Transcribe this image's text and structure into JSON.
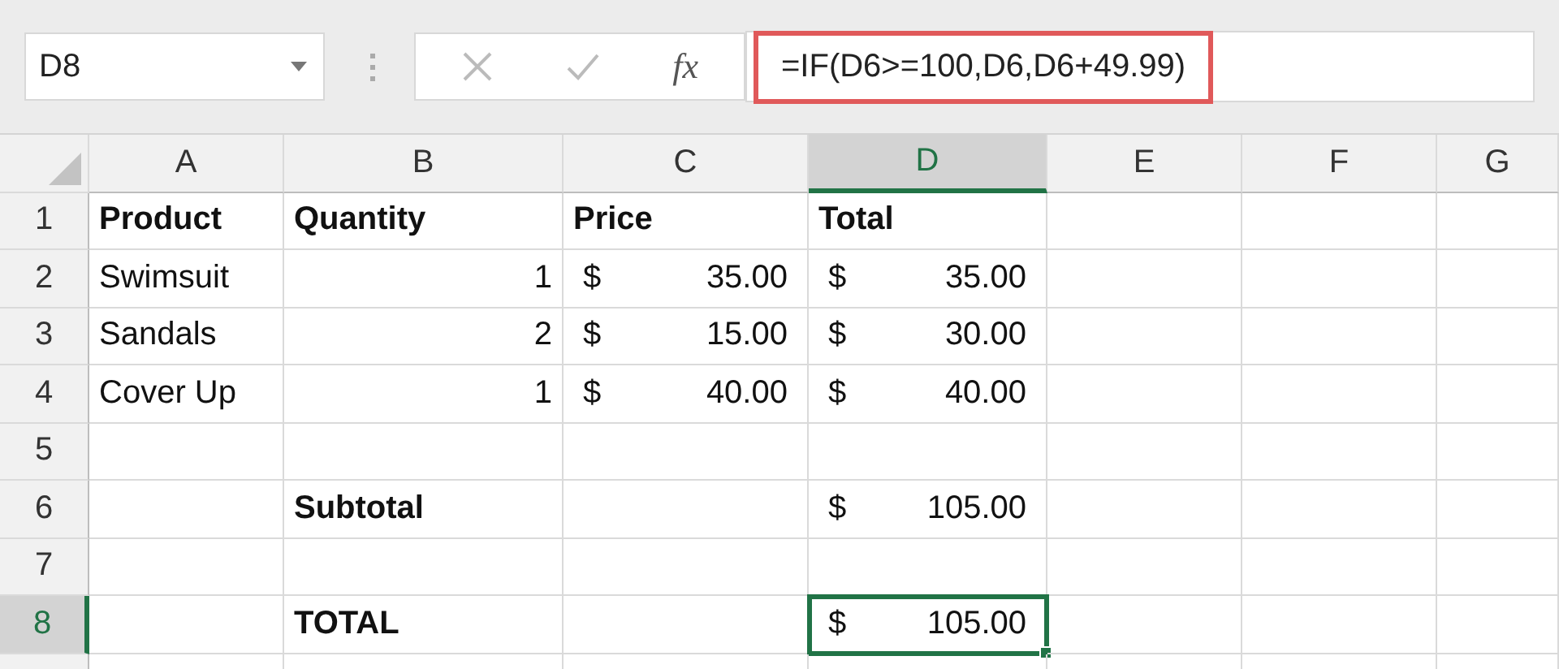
{
  "name_box": {
    "value": "D8"
  },
  "formula_bar": {
    "function_label": "fx",
    "formula": "=IF(D6>=100,D6,D6+49.99)",
    "highlighted": true
  },
  "columns": [
    {
      "label": "A",
      "selected": false
    },
    {
      "label": "B",
      "selected": false
    },
    {
      "label": "C",
      "selected": false
    },
    {
      "label": "D",
      "selected": true
    },
    {
      "label": "E",
      "selected": false
    },
    {
      "label": "F",
      "selected": false
    },
    {
      "label": "G",
      "selected": false
    }
  ],
  "rows": [
    {
      "label": "1",
      "selected": false,
      "cells": [
        {
          "kind": "text",
          "text": "Product",
          "bold": true
        },
        {
          "kind": "text",
          "text": "Quantity",
          "bold": true
        },
        {
          "kind": "text",
          "text": "Price",
          "bold": true
        },
        {
          "kind": "text",
          "text": "Total",
          "bold": true,
          "selected": false
        },
        {
          "kind": "empty"
        },
        {
          "kind": "empty"
        },
        {
          "kind": "empty"
        }
      ]
    },
    {
      "label": "2",
      "selected": false,
      "cells": [
        {
          "kind": "text",
          "text": "Swimsuit",
          "bold": false
        },
        {
          "kind": "number",
          "text": "1"
        },
        {
          "kind": "accounting",
          "symbol": "$",
          "amount": "35.00"
        },
        {
          "kind": "accounting",
          "symbol": "$",
          "amount": "35.00",
          "selected": false
        },
        {
          "kind": "empty"
        },
        {
          "kind": "empty"
        },
        {
          "kind": "empty"
        }
      ]
    },
    {
      "label": "3",
      "selected": false,
      "cells": [
        {
          "kind": "text",
          "text": "Sandals",
          "bold": false
        },
        {
          "kind": "number",
          "text": "2"
        },
        {
          "kind": "accounting",
          "symbol": "$",
          "amount": "15.00"
        },
        {
          "kind": "accounting",
          "symbol": "$",
          "amount": "30.00",
          "selected": false
        },
        {
          "kind": "empty"
        },
        {
          "kind": "empty"
        },
        {
          "kind": "empty"
        }
      ]
    },
    {
      "label": "4",
      "selected": false,
      "cells": [
        {
          "kind": "text",
          "text": "Cover Up",
          "bold": false
        },
        {
          "kind": "number",
          "text": "1"
        },
        {
          "kind": "accounting",
          "symbol": "$",
          "amount": "40.00"
        },
        {
          "kind": "accounting",
          "symbol": "$",
          "amount": "40.00",
          "selected": false
        },
        {
          "kind": "empty"
        },
        {
          "kind": "empty"
        },
        {
          "kind": "empty"
        }
      ]
    },
    {
      "label": "5",
      "selected": false,
      "cells": [
        {
          "kind": "empty"
        },
        {
          "kind": "empty"
        },
        {
          "kind": "empty"
        },
        {
          "kind": "empty"
        },
        {
          "kind": "empty"
        },
        {
          "kind": "empty"
        },
        {
          "kind": "empty"
        }
      ]
    },
    {
      "label": "6",
      "selected": false,
      "cells": [
        {
          "kind": "empty"
        },
        {
          "kind": "text",
          "text": "Subtotal",
          "bold": true
        },
        {
          "kind": "empty"
        },
        {
          "kind": "accounting",
          "symbol": "$",
          "amount": "105.00",
          "selected": false
        },
        {
          "kind": "empty"
        },
        {
          "kind": "empty"
        },
        {
          "kind": "empty"
        }
      ]
    },
    {
      "label": "7",
      "selected": false,
      "cells": [
        {
          "kind": "empty"
        },
        {
          "kind": "empty"
        },
        {
          "kind": "empty"
        },
        {
          "kind": "empty"
        },
        {
          "kind": "empty"
        },
        {
          "kind": "empty"
        },
        {
          "kind": "empty"
        }
      ]
    },
    {
      "label": "8",
      "selected": true,
      "cells": [
        {
          "kind": "empty"
        },
        {
          "kind": "text",
          "text": "TOTAL",
          "bold": true
        },
        {
          "kind": "empty"
        },
        {
          "kind": "accounting",
          "symbol": "$",
          "amount": "105.00",
          "selected": true
        },
        {
          "kind": "empty"
        },
        {
          "kind": "empty"
        },
        {
          "kind": "empty"
        }
      ]
    }
  ]
}
